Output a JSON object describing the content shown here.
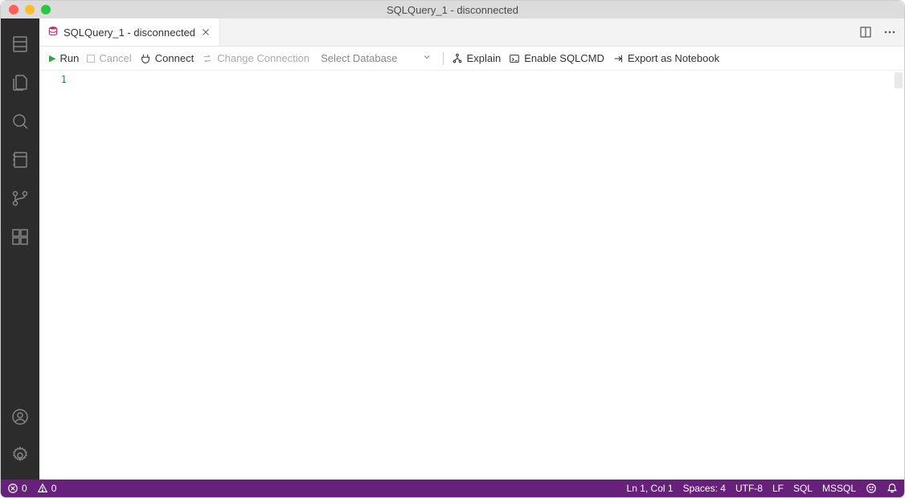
{
  "window": {
    "title": "SQLQuery_1 - disconnected"
  },
  "tab": {
    "label": "SQLQuery_1 - disconnected"
  },
  "toolbar": {
    "run": "Run",
    "cancel": "Cancel",
    "connect": "Connect",
    "change_connection": "Change Connection",
    "select_database": "Select Database",
    "explain": "Explain",
    "enable_sqlcmd": "Enable SQLCMD",
    "export_notebook": "Export as Notebook"
  },
  "editor": {
    "line_number": "1"
  },
  "status": {
    "errors": "0",
    "warnings": "0",
    "cursor": "Ln 1, Col 1",
    "spaces": "Spaces: 4",
    "encoding": "UTF-8",
    "eol": "LF",
    "language": "SQL",
    "engine": "MSSQL"
  }
}
